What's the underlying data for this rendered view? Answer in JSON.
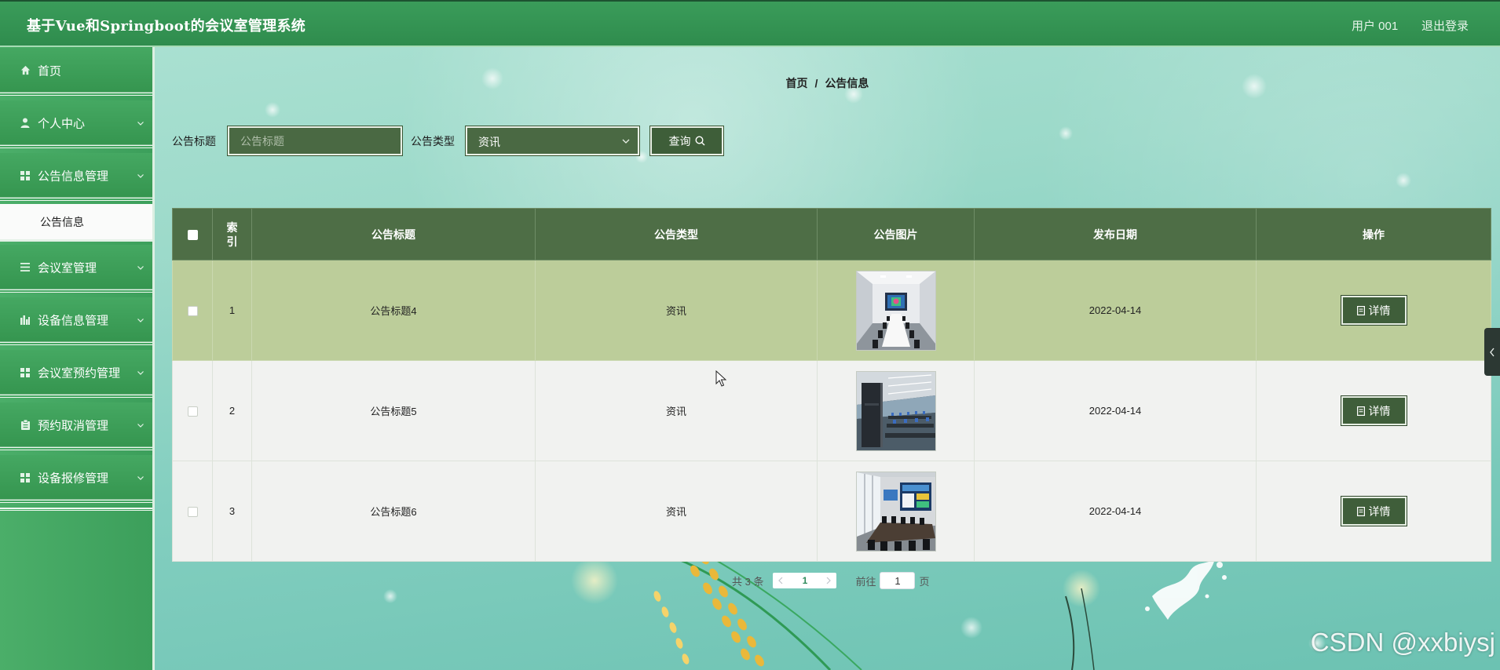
{
  "header": {
    "title": "基于Vue和Springboot的会议室管理系统",
    "user": "用户 001",
    "logout": "退出登录"
  },
  "sidebar": {
    "items": [
      {
        "label": "首页",
        "icon": "home-icon"
      },
      {
        "label": "个人中心",
        "icon": "user-icon"
      },
      {
        "label": "公告信息管理",
        "icon": "grid-icon",
        "children": [
          {
            "label": "公告信息"
          }
        ]
      },
      {
        "label": "会议室管理",
        "icon": "list-icon"
      },
      {
        "label": "设备信息管理",
        "icon": "chart-icon"
      },
      {
        "label": "会议室预约管理",
        "icon": "grid-icon"
      },
      {
        "label": "预约取消管理",
        "icon": "clipboard-icon"
      },
      {
        "label": "设备报修管理",
        "icon": "grid-icon"
      }
    ]
  },
  "breadcrumb": {
    "home": "首页",
    "separator": "/",
    "current": "公告信息"
  },
  "search": {
    "title_label": "公告标题",
    "title_placeholder": "公告标题",
    "type_label": "公告类型",
    "type_value": "资讯",
    "query_button": "查询"
  },
  "table": {
    "columns": {
      "index": "索引",
      "title": "公告标题",
      "type": "公告类型",
      "image": "公告图片",
      "date": "发布日期",
      "action": "操作"
    },
    "rows": [
      {
        "index": "1",
        "title": "公告标题4",
        "type": "资讯",
        "date": "2022-04-14",
        "action": "详情",
        "highlighted": true
      },
      {
        "index": "2",
        "title": "公告标题5",
        "type": "资讯",
        "date": "2022-04-14",
        "action": "详情"
      },
      {
        "index": "3",
        "title": "公告标题6",
        "type": "资讯",
        "date": "2022-04-14",
        "action": "详情"
      }
    ]
  },
  "pagination": {
    "total": "共 3 条",
    "current_page": "1",
    "goto_label": "前往",
    "goto_value": "1",
    "page_suffix": "页"
  },
  "watermark": "CSDN @xxbiysj",
  "colors": {
    "header": "#34955a",
    "sidebar": "#41a35e",
    "table_header": "#4e6e46",
    "row_highlight": "#bccd9a",
    "row": "#f1f2f0",
    "button": "#3e5f39",
    "accent": "#2d8a5a"
  }
}
